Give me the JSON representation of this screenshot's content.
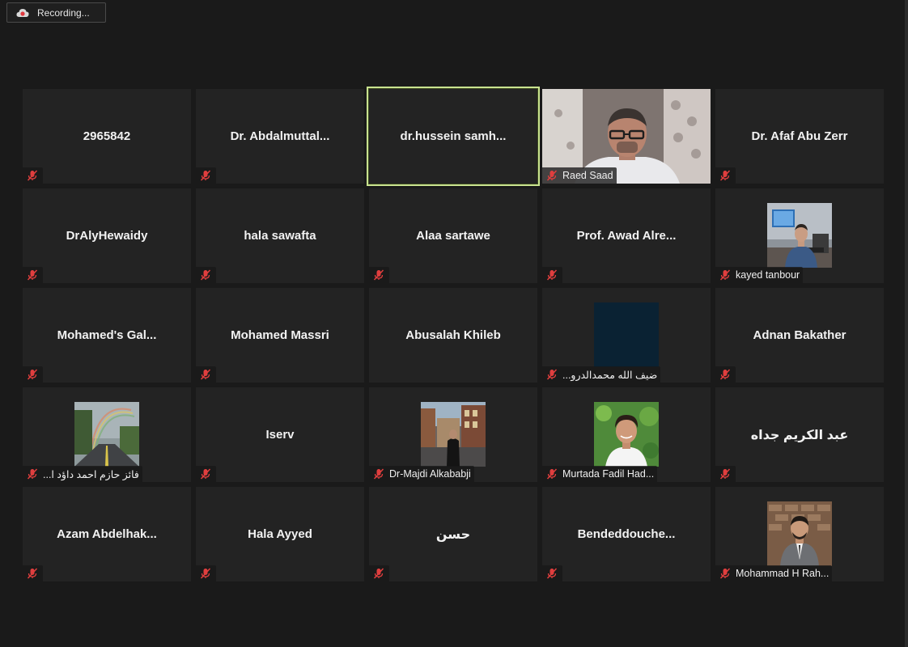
{
  "recording": {
    "label": "Recording..."
  },
  "tiles": [
    {
      "name": "2965842"
    },
    {
      "name": "Dr.  Abdalmuttal..."
    },
    {
      "name": "dr.hussein  samh..."
    },
    {
      "label": "Raed Saad"
    },
    {
      "name": "Dr. Afaf Abu Zerr"
    },
    {
      "name": "DrAlyHewaidy"
    },
    {
      "name": "hala sawafta"
    },
    {
      "name": "Alaa sartawe"
    },
    {
      "name": "Prof.  Awad  Alre..."
    },
    {
      "label": "kayed tanbour"
    },
    {
      "name": "Mohamed's  Gal..."
    },
    {
      "name": "Mohamed Massri"
    },
    {
      "name": "Abusalah Khileb"
    },
    {
      "label": "ضيف الله محمدالدرو..."
    },
    {
      "name": "Adnan Bakather"
    },
    {
      "label": "فائز حازم احمد داؤد ا..."
    },
    {
      "name": "Iserv"
    },
    {
      "label": "Dr-Majdi Alkababji"
    },
    {
      "label": "Murtada Fadil Had..."
    },
    {
      "name": "عبد الكريم جداه"
    },
    {
      "name": "Azam  Abdelhak..."
    },
    {
      "name": "Hala Ayyed"
    },
    {
      "name": "حسن"
    },
    {
      "name": "Bendeddouche..."
    },
    {
      "label": "Mohammad H Rah..."
    }
  ]
}
